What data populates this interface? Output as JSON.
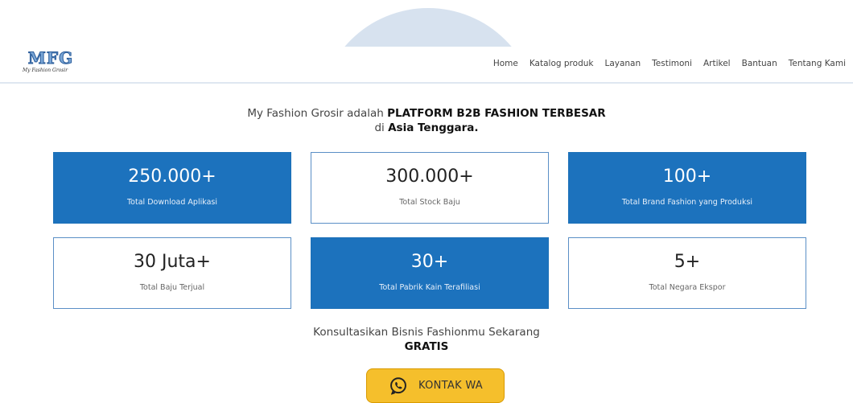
{
  "header": {
    "logo_text": "MFG",
    "logo_tagline": "My Fashion Grosir",
    "nav": [
      {
        "label": "Home"
      },
      {
        "label": "Katalog produk"
      },
      {
        "label": "Layanan"
      },
      {
        "label": "Testimoni"
      },
      {
        "label": "Artikel"
      },
      {
        "label": "Bantuan"
      },
      {
        "label": "Tentang Kami"
      }
    ]
  },
  "intro": {
    "part1": "My Fashion Grosir adalah ",
    "bold1": "PLATFORM B2B FASHION TERBESAR",
    "part2": " di ",
    "bold2": "Asia Tenggara."
  },
  "stats": [
    {
      "value": "250.000+",
      "label": "Total Download Aplikasi",
      "style": "filled"
    },
    {
      "value": "300.000+",
      "label": "Total Stock Baju",
      "style": "plain"
    },
    {
      "value": "100+",
      "label": "Total Brand Fashion yang Produksi",
      "style": "filled"
    },
    {
      "value": "30 Juta+",
      "label": "Total Baju Terjual",
      "style": "plain"
    },
    {
      "value": "30+",
      "label": "Total Pabrik Kain Terafiliasi",
      "style": "filled"
    },
    {
      "value": "5+",
      "label": "Total Negara Ekspor",
      "style": "plain"
    }
  ],
  "cta": {
    "line1": "Konsultasikan Bisnis Fashionmu Sekarang",
    "line2": "GRATIS",
    "button_label": "KONTAK WA",
    "button_icon": "whatsapp-icon"
  },
  "colors": {
    "primary_blue": "#1c72bd",
    "button_yellow": "#f5bf2c"
  }
}
